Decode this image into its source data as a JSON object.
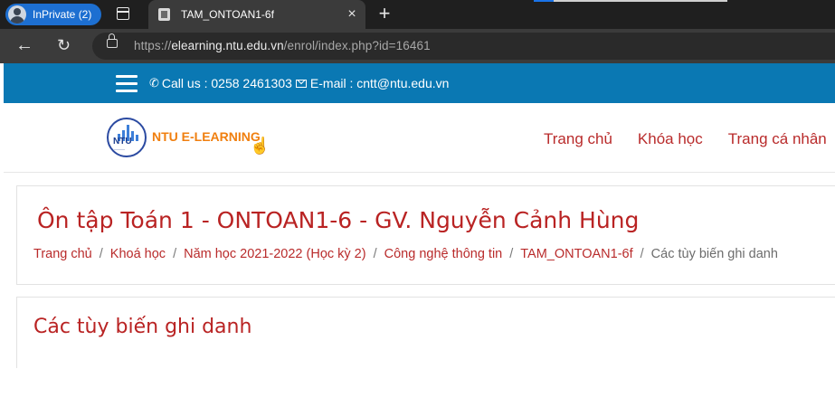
{
  "browser": {
    "profile_label": "InPrivate (2)",
    "tab_title": "TAM_ONTOAN1-6f",
    "tab_close": "×",
    "new_tab": "+",
    "url_prefix": "https://",
    "url_host": "elearning.ntu.edu.vn",
    "url_path": "/enrol/index.php?id=16461",
    "back_glyph": "←",
    "reload_glyph": "↻"
  },
  "topbar": {
    "phone_glyph": "✆",
    "contact_phone": "Call us : 0258 2461303",
    "contact_email": "E-mail : cntt@ntu.edu.vn"
  },
  "header": {
    "logo_text": "NTU E-LEARNING",
    "logo_badge": "NTU",
    "nav": [
      "Trang chủ",
      "Khóa học",
      "Trang cá nhân"
    ]
  },
  "course": {
    "title": "Ôn tập Toán 1 - ONTOAN1-6 - GV. Nguyễn Cảnh Hùng",
    "breadcrumb": [
      "Trang chủ",
      "Khoá học",
      "Năm học 2021-2022 (Học kỳ 2)",
      "Công nghệ thông tin",
      "TAM_ONTOAN1-6f"
    ],
    "breadcrumb_current": "Các tùy biến ghi danh",
    "breadcrumb_sep": "/"
  },
  "section": {
    "title": "Các tùy biến ghi danh"
  },
  "colors": {
    "topbar": "#0a78b3",
    "accent_red": "#b92323",
    "logo_orange": "#f07f0f"
  }
}
